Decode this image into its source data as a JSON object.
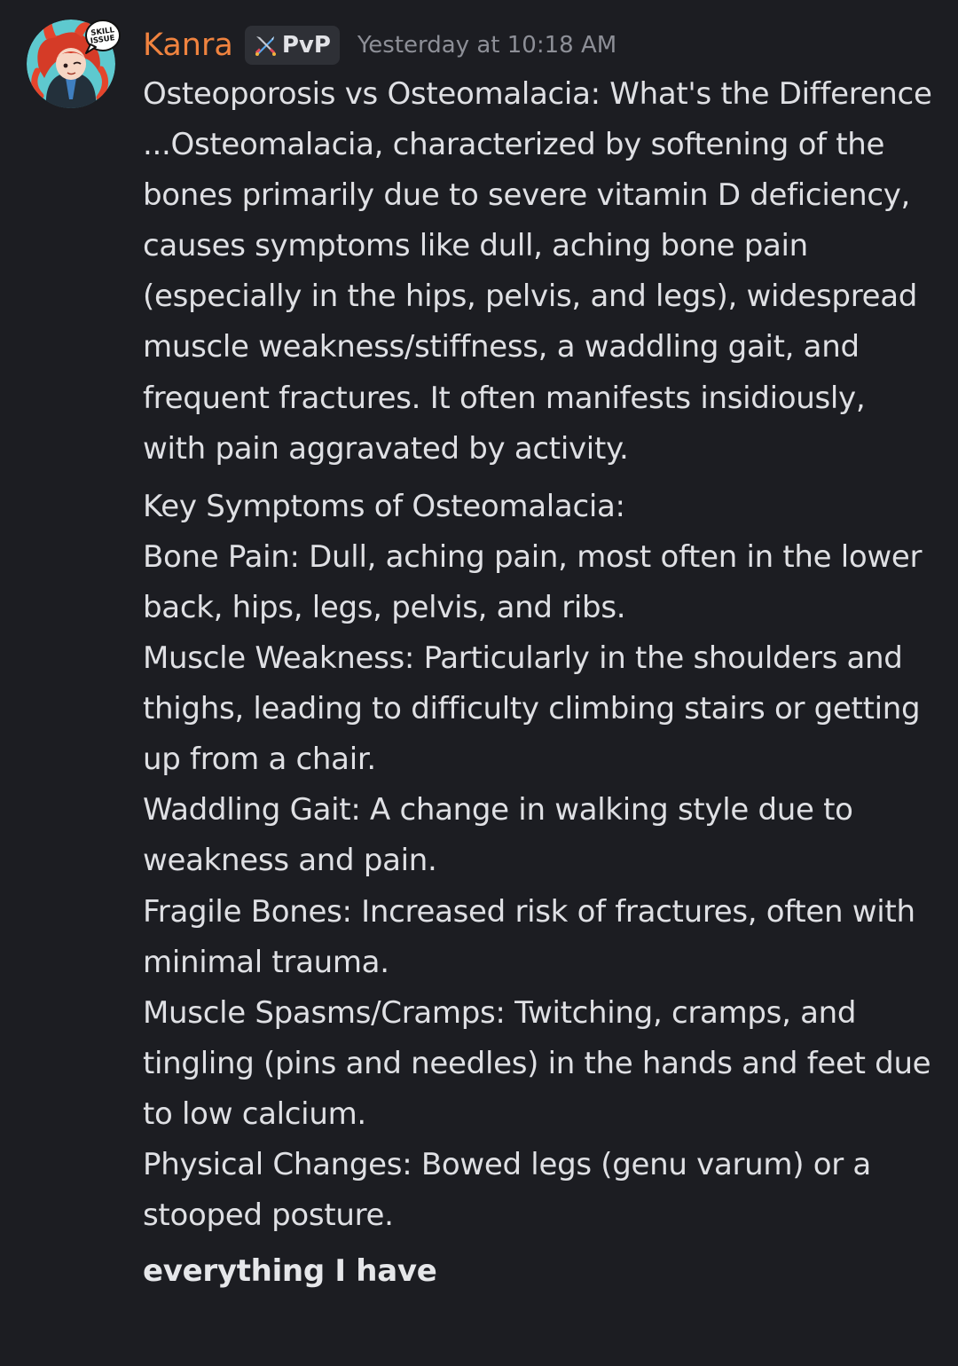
{
  "message": {
    "author": {
      "name": "Kanra",
      "name_color": "#f0833f",
      "avatar_icon": "anime-character-avatar",
      "avatar_decoration_text": [
        "SKILL",
        "ISSUE"
      ],
      "guild_tag": {
        "icon": "crossed-swords-icon",
        "label": "PvP"
      }
    },
    "timestamp": "Yesterday at 10:18 AM",
    "paragraph": "Osteoporosis vs Osteomalacia: What's the Difference ...Osteomalacia, characterized by softening of the bones primarily due to severe vitamin D deficiency, causes symptoms like dull, aching bone pain (especially in the hips, pelvis, and legs), widespread muscle weakness/stiffness, a waddling gait, and frequent fractures. It often manifests insidiously, with pain aggravated by activity.",
    "lines": [
      "Key Symptoms of Osteomalacia:",
      "Bone Pain: Dull, aching pain, most often in the lower back, hips, legs, pelvis, and ribs.",
      "Muscle Weakness: Particularly in the shoulders and thighs, leading to difficulty climbing stairs or getting up from a chair.",
      "Waddling Gait: A change in walking style due to weakness and pain.",
      "Fragile Bones: Increased risk of fractures, often with minimal trauma.",
      "Muscle Spasms/Cramps: Twitching, cramps, and tingling (pins and needles) in the hands and feet due to low calcium.",
      "Physical Changes: Bowed legs (genu varum) or a stooped posture."
    ],
    "reply": "everything I have"
  },
  "colors": {
    "background": "#1c1d22",
    "text": "#dfe0e4",
    "timestamp": "#8d8f97",
    "tag_background": "#2e3036"
  }
}
